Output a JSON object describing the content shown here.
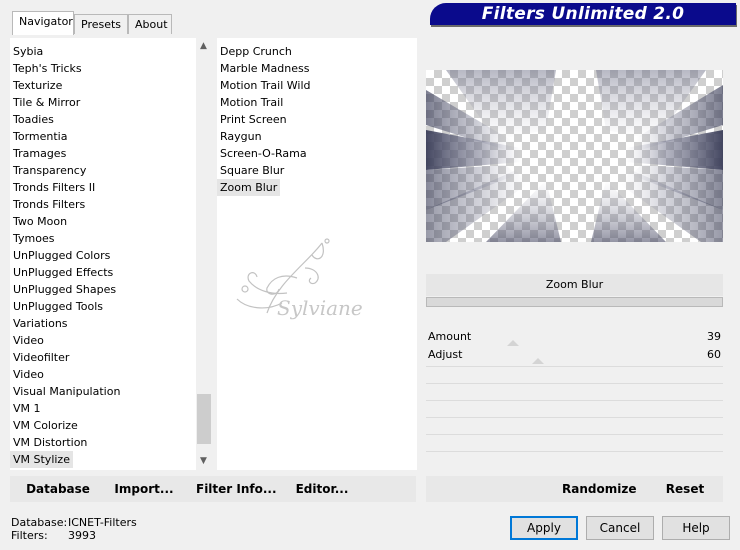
{
  "tabs": [
    "Navigator",
    "Presets",
    "About"
  ],
  "banner": "Filters Unlimited 2.0",
  "categories": [
    "Sybia",
    "Teph's Tricks",
    "Texturize",
    "Tile & Mirror",
    "Toadies",
    "Tormentia",
    "Tramages",
    "Transparency",
    "Tronds Filters II",
    "Tronds Filters",
    "Two Moon",
    "Tymoes",
    "UnPlugged Colors",
    "UnPlugged Effects",
    "UnPlugged Shapes",
    "UnPlugged Tools",
    "Variations",
    "Video",
    "Videofilter",
    "Video",
    "Visual Manipulation",
    "VM 1",
    "VM Colorize",
    "VM Distortion",
    "VM Stylize"
  ],
  "selected_category": "VM Stylize",
  "filters": [
    "Depp Crunch",
    "Marble Madness",
    "Motion Trail Wild",
    "Motion Trail",
    "Print Screen",
    "Raygun",
    "Screen-O-Rama",
    "Square Blur",
    "Zoom Blur"
  ],
  "selected_filter": "Zoom Blur",
  "watermark": "Sylviane",
  "filter_title": "Zoom Blur",
  "params": [
    {
      "label": "Amount",
      "value": "39",
      "level": 39
    },
    {
      "label": "Adjust",
      "value": "60",
      "level": 60
    }
  ],
  "toolbar": {
    "database": "Database",
    "import": "Import...",
    "filter_info": "Filter Info...",
    "editor": "Editor...",
    "randomize": "Randomize",
    "reset": "Reset"
  },
  "status": {
    "database_label": "Database:",
    "database_value": "ICNET-Filters",
    "filters_label": "Filters:",
    "filters_value": "3993"
  },
  "buttons": {
    "apply": "Apply",
    "cancel": "Cancel",
    "help": "Help"
  },
  "colors": {
    "banner": "#0a0a8c",
    "default_button_border": "#0078d7"
  }
}
